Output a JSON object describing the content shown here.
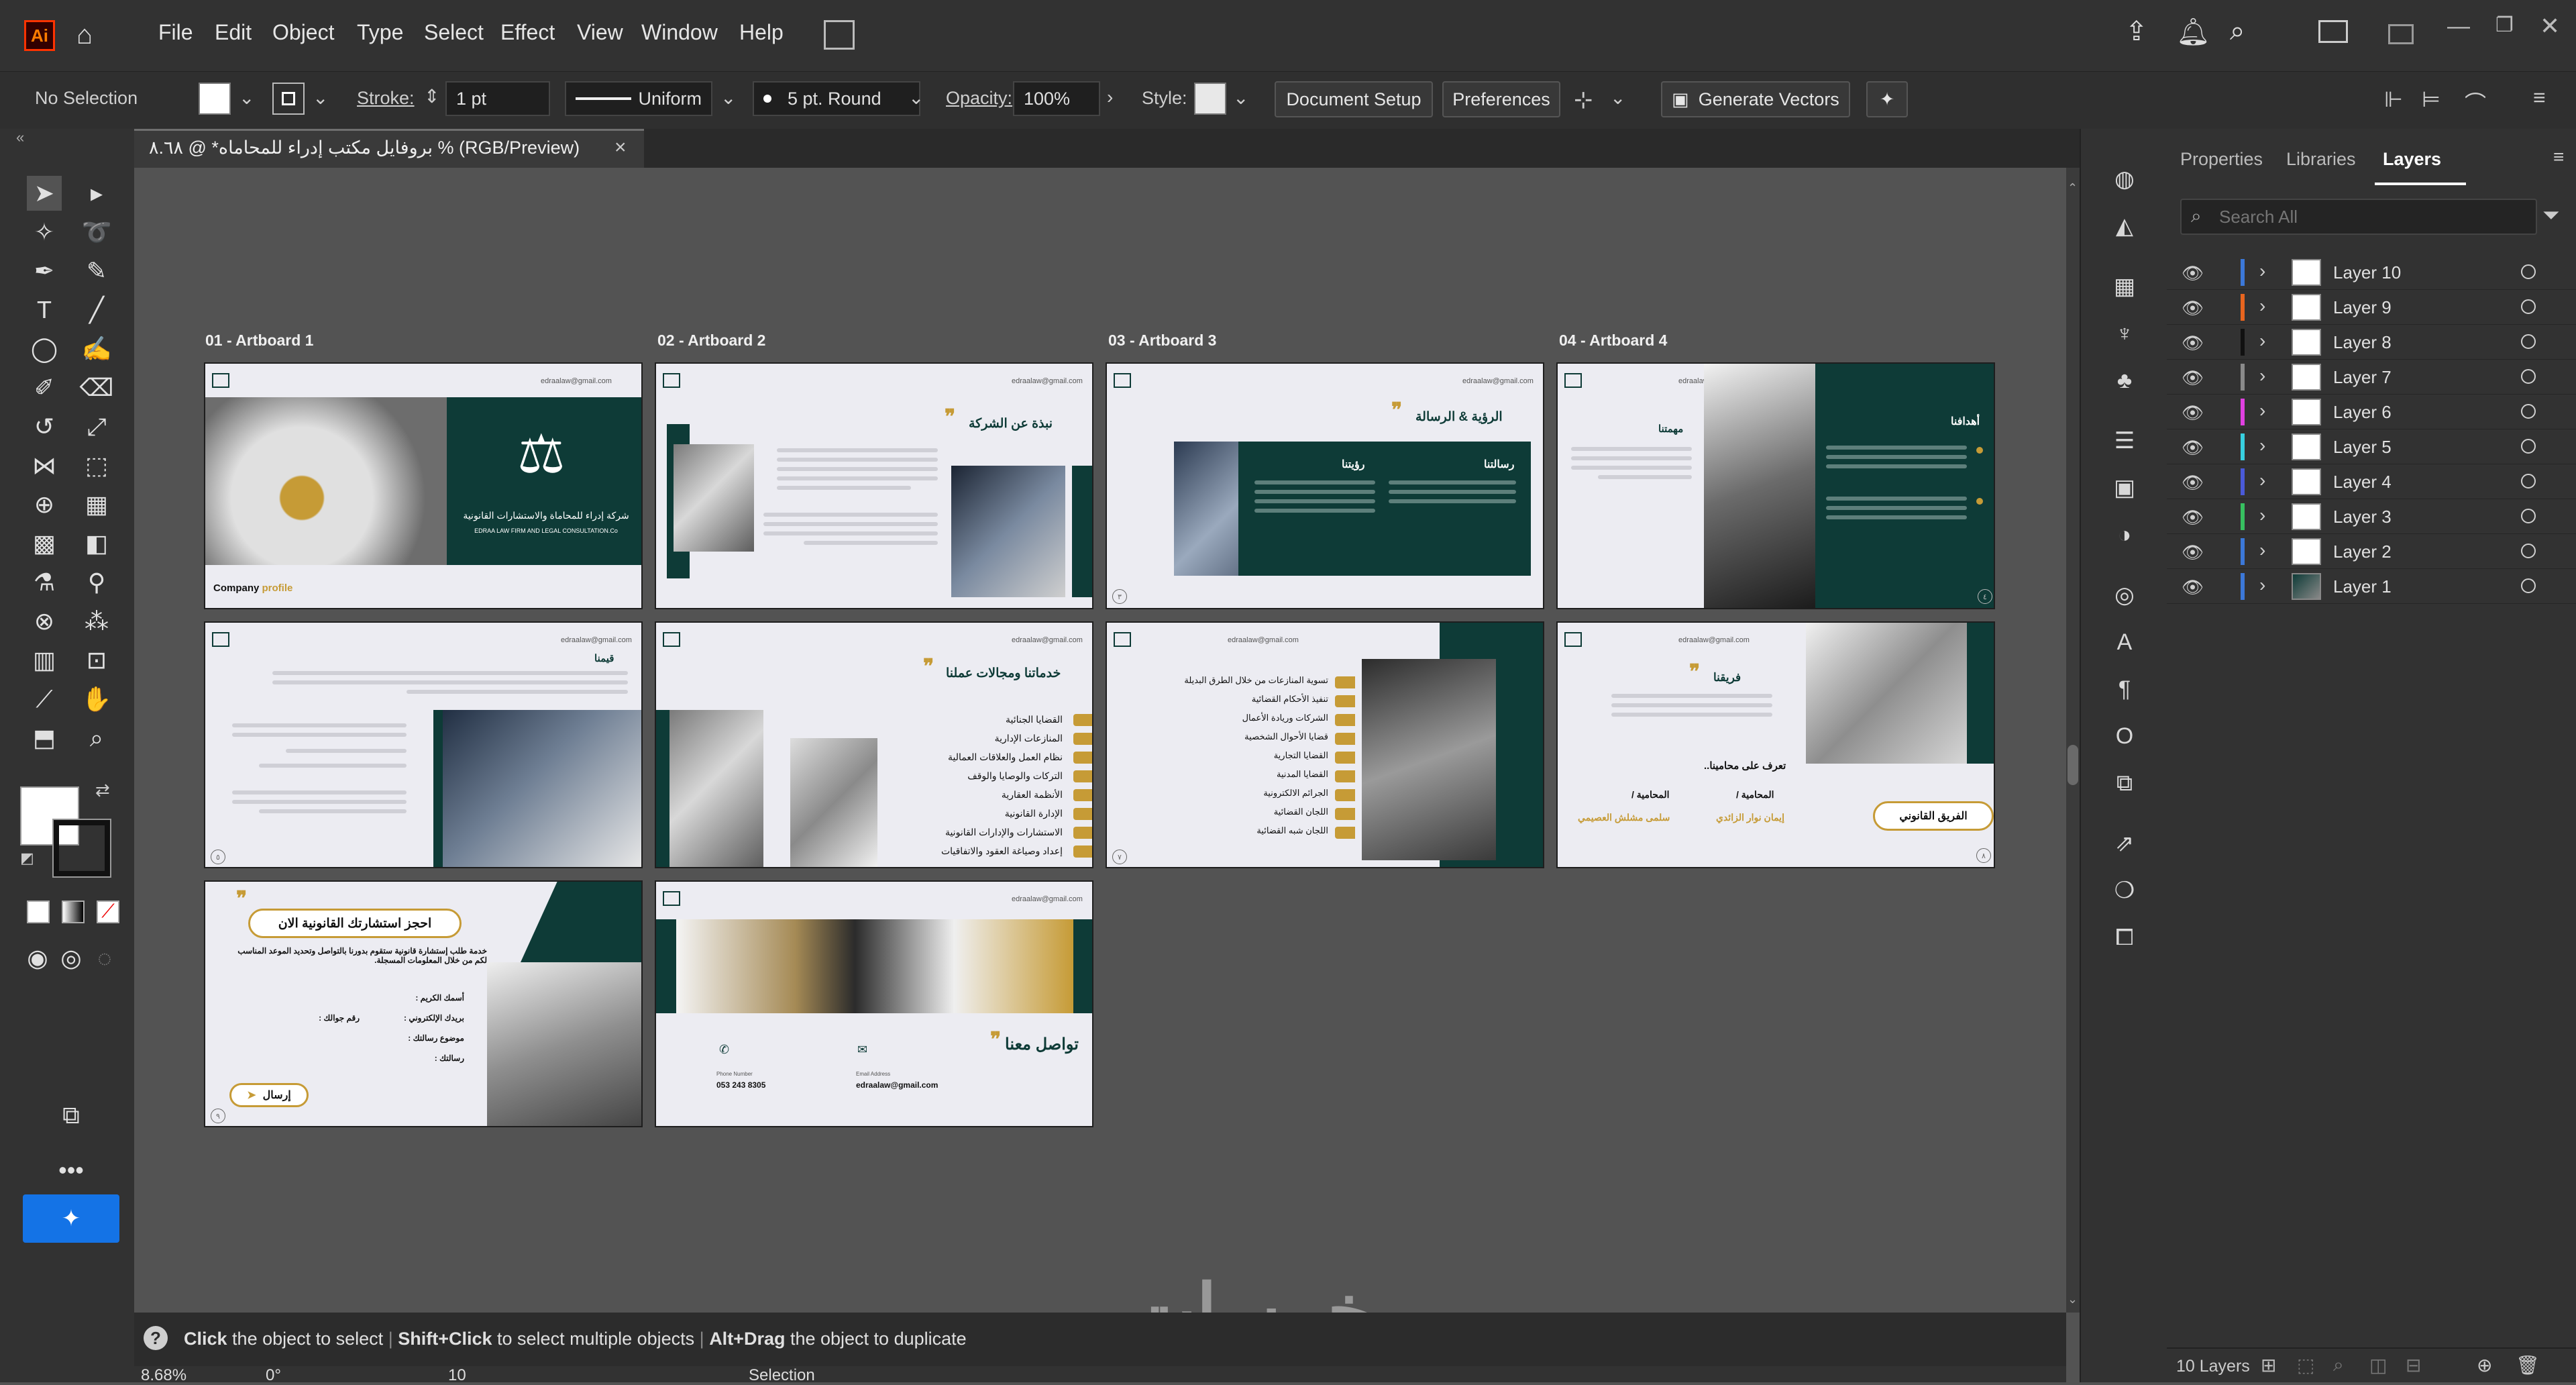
{
  "app": {
    "logo_text": "Ai",
    "menu": [
      "File",
      "Edit",
      "Object",
      "Type",
      "Select",
      "Effect",
      "View",
      "Window",
      "Help"
    ]
  },
  "control_bar": {
    "selection_state": "No Selection",
    "stroke_label": "Stroke:",
    "stroke_weight": "1 pt",
    "profile": "Uniform",
    "brush": "5 pt. Round",
    "opacity_label": "Opacity:",
    "opacity_value": "100%",
    "style_label": "Style:",
    "document_setup": "Document Setup",
    "preferences": "Preferences",
    "generate_vectors": "Generate Vectors"
  },
  "document_tab": {
    "title": "بروفايل مكتب إدراء للمحاماه* @ ٨.٦٨ % (RGB/Preview)",
    "close": "×"
  },
  "artboards": [
    {
      "label": "01 - Artboard 1",
      "title": "",
      "caption_a": "Company",
      "caption_b": "profile",
      "firm_ar": "شركة إدراء للمحاماة والاستشارات القانونية",
      "firm_en": "EDRAA LAW FIRM AND LEGAL CONSULTATION.Co"
    },
    {
      "label": "02 - Artboard 2",
      "title": "نبذة عن الشركة"
    },
    {
      "label": "03 - Artboard 3",
      "title": "الرؤية & الرسالة",
      "sub_a": "رؤيتنا",
      "sub_b": "رسالتنا"
    },
    {
      "label": "04 - Artboard 4",
      "title": "أهدافنا",
      "sub_a": "مهمتنا"
    },
    {
      "label": "",
      "title": "قيمنا"
    },
    {
      "label": "",
      "title": "خدماتنا ومجالات عملنا",
      "items": [
        "القضايا الجنائية",
        "المنازعات الإدارية",
        "نظام العمل والعلاقات العمالية",
        "التركات والوصايا والوقف",
        "الأنظمة العقارية",
        "الإدارة القانونية",
        "الاستشارات والإدارات القانونية",
        "إعداد وصياغة العقود والاتفاقيات"
      ]
    },
    {
      "label": "",
      "title": "",
      "items": [
        "تسوية المنازعات من خلال الطرق البديلة",
        "تنفيذ الأحكام القضائية",
        "الشركات وريادة الأعمال",
        "قضايا الأحوال الشخصية",
        "القضايا التجارية",
        "القضايا المدنية",
        "الجرائم الالكترونية",
        "اللجان القضائية",
        "اللجان شبه القضائية"
      ]
    },
    {
      "label": "",
      "title": "فريقنا",
      "sub_a": "تعرف على محامينا..",
      "role_1": "المحامية /",
      "name_1": "إيمان نوار الزائدي",
      "role_2": "المحامية /",
      "name_2": "سلمى مشلش العصيمي",
      "badge": "الفريق القانوني"
    },
    {
      "label": "",
      "title": "احجز استشارتك القانونية الان",
      "desc": "خدمة طلب إستشارة قانونية ستقوم بدورنا بالتواصل وتحديد الموعد المناسب لكم من خلال المعلومات المسجلة.",
      "fields": [
        "أسمك الكريم :",
        "بريدك الإلكتروني :",
        "رقم جوالك :",
        "موضوع رسالتك :",
        "رسالتك :"
      ],
      "send": "إرسال"
    },
    {
      "label": "",
      "title": "تواصل معنا",
      "phone_label": "Phone Number",
      "phone": "053 243 8305",
      "email_label": "Email Address",
      "email": "edraalaw@gmail.com"
    }
  ],
  "email_small": "edraalaw@gmail.com",
  "panel": {
    "tabs": [
      "Properties",
      "Libraries",
      "Layers"
    ],
    "search_placeholder": "Search All",
    "layers": [
      {
        "name": "Layer 10",
        "color": "#3c78d8"
      },
      {
        "name": "Layer 9",
        "color": "#e8651f"
      },
      {
        "name": "Layer 8",
        "color": "#111111"
      },
      {
        "name": "Layer 7",
        "color": "#8a8a8a"
      },
      {
        "name": "Layer 6",
        "color": "#e040e0"
      },
      {
        "name": "Layer 5",
        "color": "#38d0e0"
      },
      {
        "name": "Layer 4",
        "color": "#4a5ad8"
      },
      {
        "name": "Layer 3",
        "color": "#37c060"
      },
      {
        "name": "Layer 2",
        "color": "#3c78d8"
      },
      {
        "name": "Layer 1",
        "color": "#3c78d8"
      }
    ],
    "layer_count": "10 Layers"
  },
  "hint": {
    "a_bold": "Click",
    "a": " the object to select",
    "b_bold": "Shift+Click",
    "b": " to select multiple objects",
    "c_bold": "Alt+Drag",
    "c": " the object to duplicate"
  },
  "status": {
    "zoom": "8.68%",
    "rotation": "0°",
    "artboard_num": "10",
    "mode": "Selection"
  },
  "watermark": "خمسات"
}
